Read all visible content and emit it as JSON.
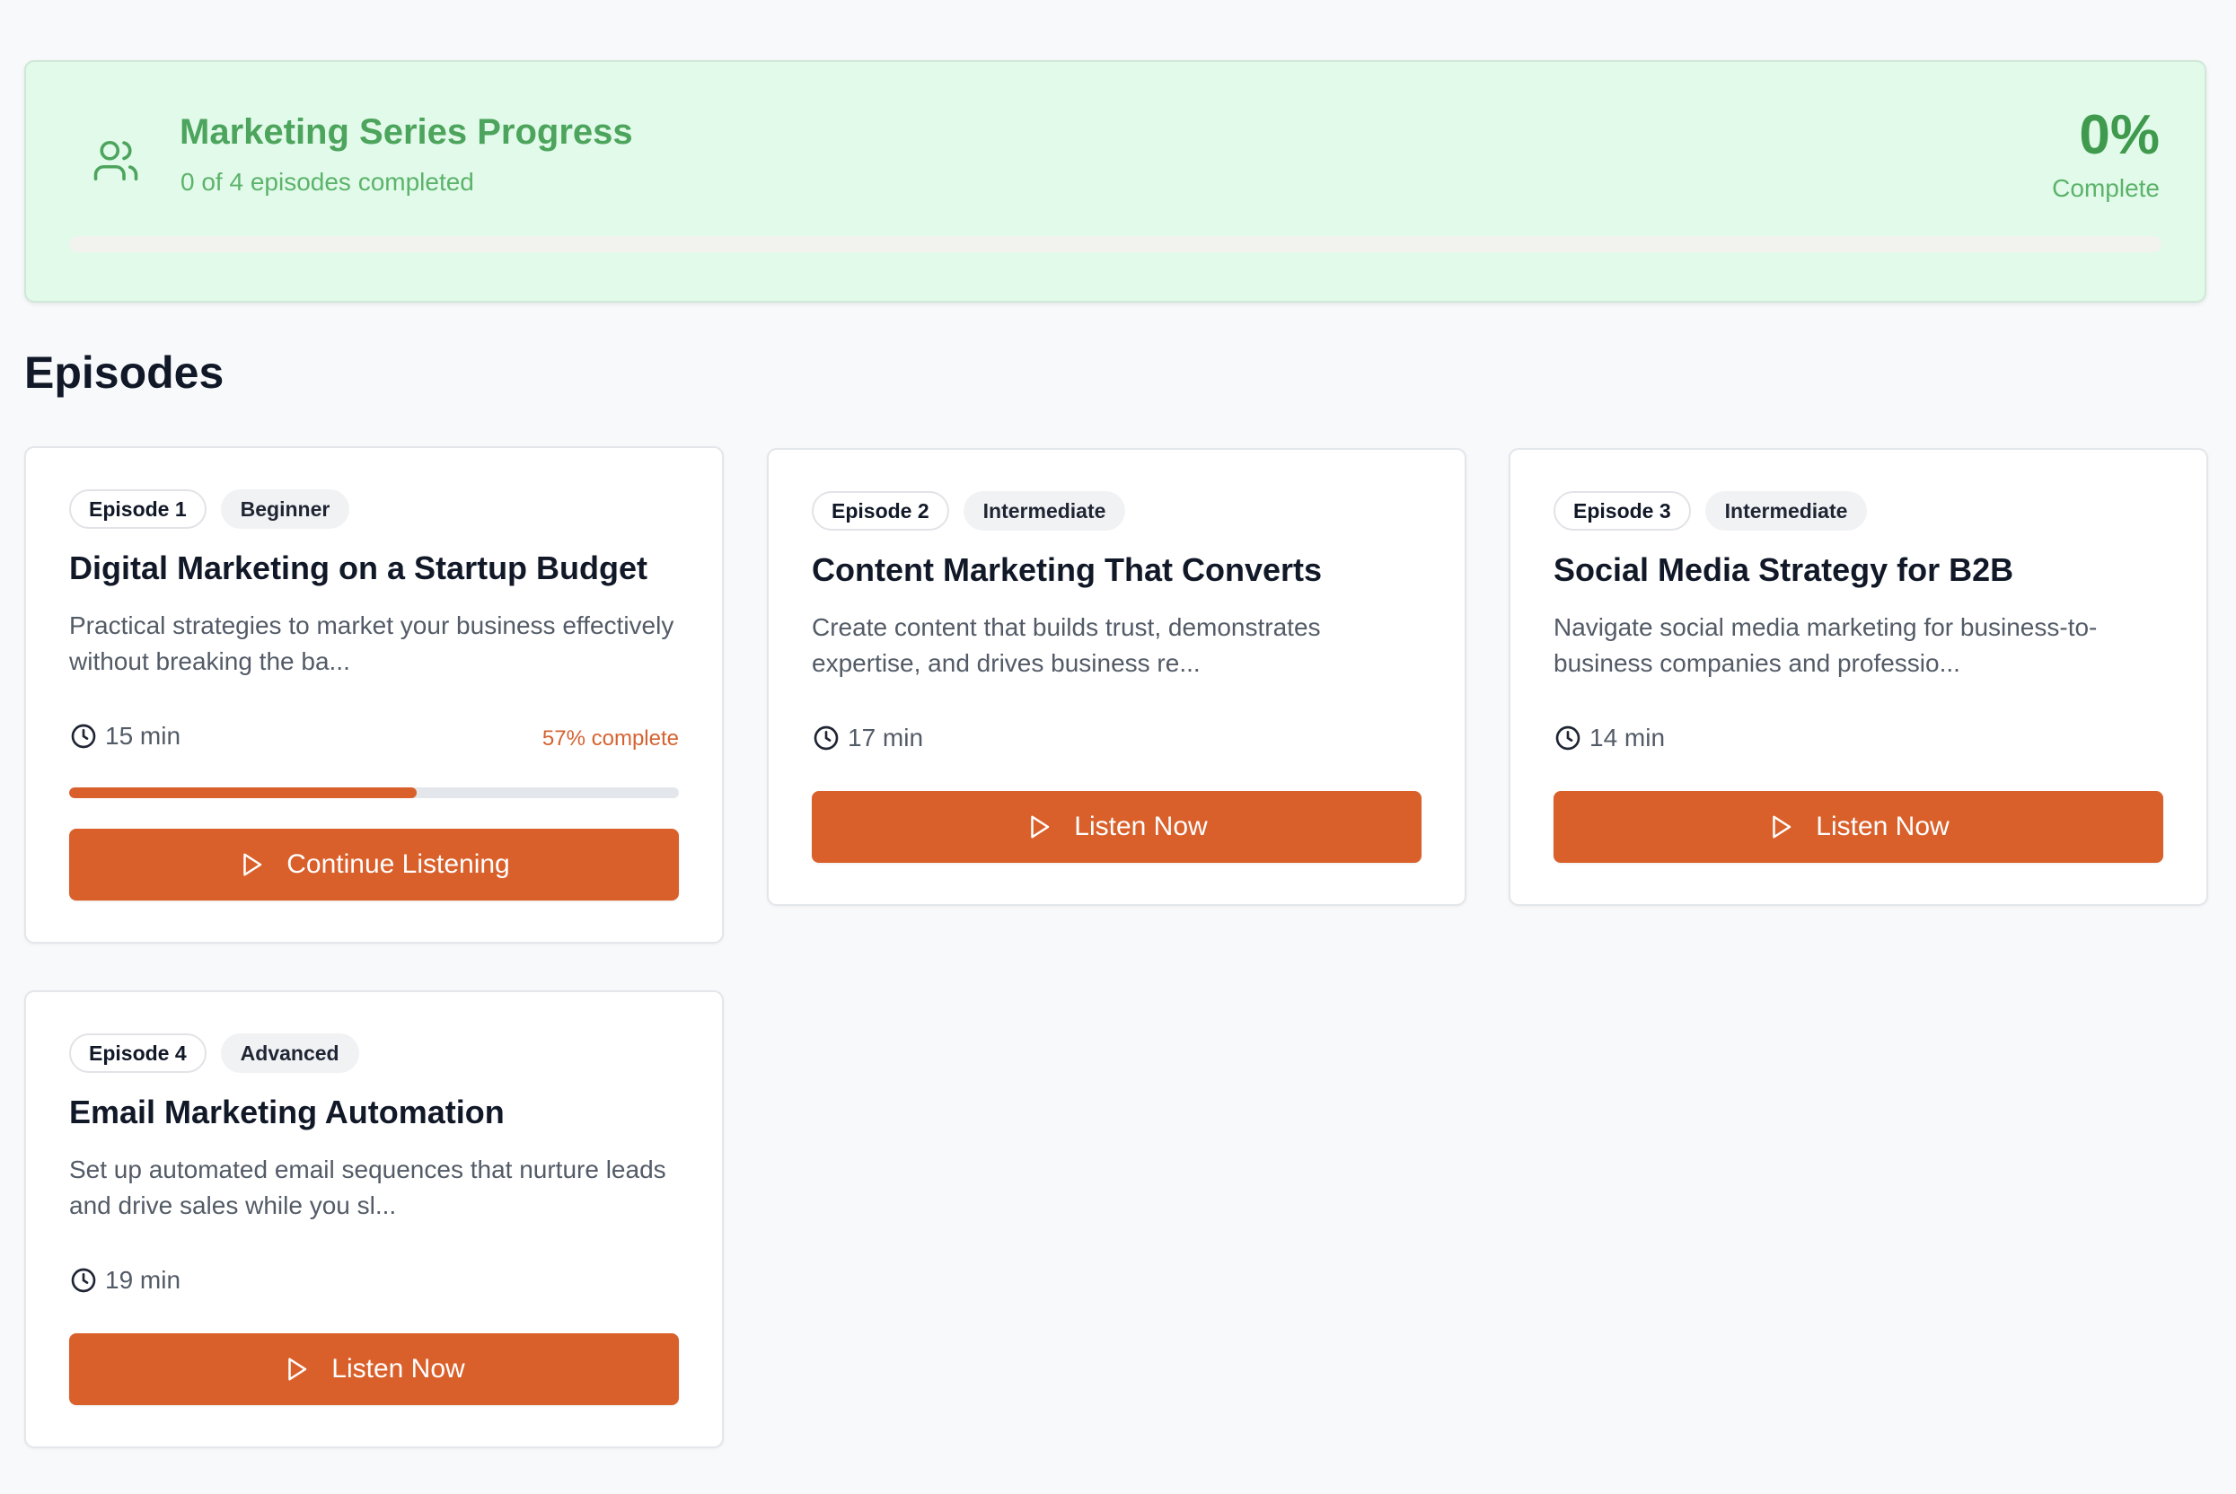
{
  "series": {
    "title": "Marketing Series Progress",
    "subtitle": "0 of 4 episodes completed",
    "percent": "0%",
    "percent_label": "Complete",
    "progress_fraction": 0,
    "icon": "users-icon",
    "color": "#4da45c"
  },
  "heading": "Episodes",
  "accent_color": "#d9602b",
  "episodes": [
    {
      "badge": "Episode 1",
      "level": "Beginner",
      "title": "Digital Marketing on a Startup Budget",
      "description": "Practical strategies to market your business effectively without breaking the ba...",
      "duration": "15 min",
      "progress_text": "57% complete",
      "progress_fraction": 0.57,
      "button": "Continue Listening"
    },
    {
      "badge": "Episode 2",
      "level": "Intermediate",
      "title": "Content Marketing That Converts",
      "description": "Create content that builds trust, demonstrates expertise, and drives business re...",
      "duration": "17 min",
      "button": "Listen Now"
    },
    {
      "badge": "Episode 3",
      "level": "Intermediate",
      "title": "Social Media Strategy for B2B",
      "description": "Navigate social media marketing for business-to-business companies and professio...",
      "duration": "14 min",
      "button": "Listen Now"
    },
    {
      "badge": "Episode 4",
      "level": "Advanced",
      "title": "Email Marketing Automation",
      "description": "Set up automated email sequences that nurture leads and drive sales while you sl...",
      "duration": "19 min",
      "button": "Listen Now"
    }
  ]
}
